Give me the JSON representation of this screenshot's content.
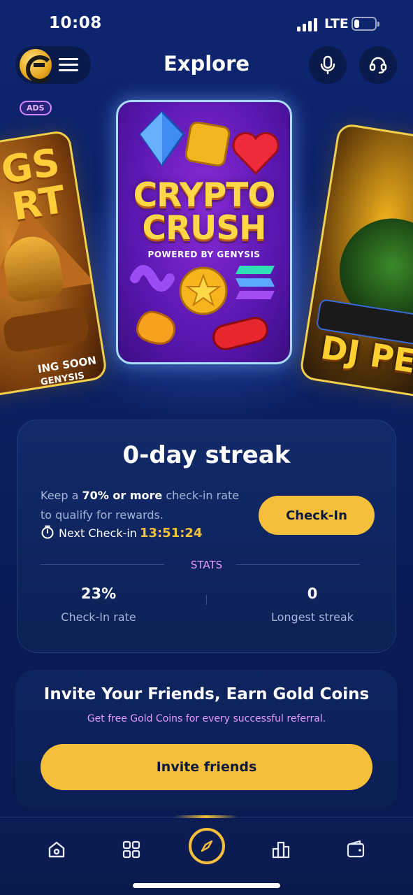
{
  "status_bar": {
    "time": "10:08",
    "network": "LTE",
    "battery_level": 0.25
  },
  "header": {
    "title": "Explore"
  },
  "carousel": {
    "ads_badge": "ADS",
    "cards": [
      {
        "title_lines": [
          "GS",
          "RT"
        ],
        "footer": "ING SOON",
        "powered": "GENYSIS"
      },
      {
        "title_lines": [
          "CRYPTO",
          "CRUSH"
        ],
        "subtitle": "POWERED BY GENYSIS"
      },
      {
        "title": "DJ PE"
      }
    ]
  },
  "streak": {
    "title": "0-day streak",
    "desc_before": "Keep a ",
    "desc_bold": "70% or more",
    "desc_after": " check-in rate to qualify for rewards.",
    "next_label": "Next Check-in",
    "countdown": "13:51:24",
    "checkin_label": "Check-In",
    "stats_label": "STATS",
    "stats": [
      {
        "value": "23%",
        "label": "Check-In rate"
      },
      {
        "value": "0",
        "label": "Longest streak"
      }
    ]
  },
  "invite": {
    "title": "Invite Your Friends, Earn Gold Coins",
    "subtitle": "Get free Gold Coins for every successful referral.",
    "button_label": "Invite friends"
  },
  "nav": {
    "items": [
      {
        "icon": "home-icon"
      },
      {
        "icon": "grid-icon"
      },
      {
        "icon": "compass-icon",
        "active": true
      },
      {
        "icon": "leaderboard-icon"
      },
      {
        "icon": "wallet-icon"
      }
    ]
  },
  "colors": {
    "accent": "#f5bf3b",
    "highlight": "#e79cff",
    "background": "#0c2164"
  }
}
